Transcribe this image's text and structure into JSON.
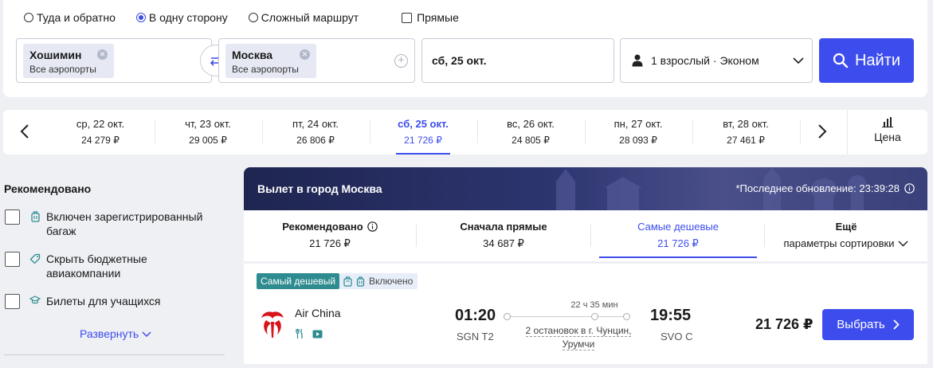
{
  "search": {
    "trip_types": [
      {
        "label": "Туда и обратно",
        "checked": false
      },
      {
        "label": "В одну сторону",
        "checked": true
      },
      {
        "label": "Сложный маршрут",
        "checked": false
      }
    ],
    "direct_only_label": "Прямые",
    "origin": {
      "city": "Хошимин",
      "sub": "Все аэропорты"
    },
    "destination": {
      "city": "Москва",
      "sub": "Все аэропорты"
    },
    "date": "сб, 25 окт.",
    "passengers": "1 взрослый · Эконом",
    "find_label": "Найти"
  },
  "date_strip": {
    "days": [
      {
        "date": "ср, 22 окт.",
        "price": "24 279 ₽"
      },
      {
        "date": "чт, 23 окт.",
        "price": "29 005 ₽"
      },
      {
        "date": "пт, 24 окт.",
        "price": "26 806 ₽"
      },
      {
        "date": "сб, 25 окт.",
        "price": "21 726 ₽",
        "active": true
      },
      {
        "date": "вс, 26 окт.",
        "price": "24 805 ₽"
      },
      {
        "date": "пн, 27 окт.",
        "price": "28 093 ₽"
      },
      {
        "date": "вт, 28 окт.",
        "price": "27 461 ₽"
      }
    ],
    "price_label": "Цена"
  },
  "filters": {
    "title": "Рекомендовано",
    "items": [
      {
        "line1": "Включен зарегистрированный",
        "line2": "багаж",
        "icon": "baggage-icon"
      },
      {
        "line1": "Скрыть бюджетные",
        "line2": "авиакомпании",
        "icon": "tag-icon"
      },
      {
        "line1": "Билеты для учащихся",
        "line2": "",
        "icon": "graduation-cap-icon"
      }
    ],
    "expand_label": "Развернуть"
  },
  "results": {
    "title": "Вылет в город Москва",
    "last_update": "*Последнее обновление: 23:39:28"
  },
  "sort_tabs": [
    {
      "title": "Рекомендовано",
      "value": "21 726 ₽",
      "info": true
    },
    {
      "title": "Сначала прямые",
      "value": "34 687 ₽"
    },
    {
      "title": "Самые дешевые",
      "value": "21 726 ₽",
      "active": true
    },
    {
      "title": "Ещё",
      "value": "параметры сортировки"
    }
  ],
  "flight": {
    "badge_cheapest": "Самый дешевый",
    "badge_included": "Включено",
    "airline": "Air China",
    "dep_time": "01:20",
    "dep_airport": "SGN T2",
    "duration": "22 ч 35 мин",
    "stops_line1": "2 остановок в г. Чунцин,",
    "stops_line2": "Урумчи",
    "arr_time": "19:55",
    "arr_airport": "SVO C",
    "price": "21 726 ₽",
    "select_label": "Выбрать"
  },
  "colors": {
    "accent": "#3d4ded",
    "cheap_badge": "#2e8b8f",
    "airline_red": "#d7141a"
  }
}
